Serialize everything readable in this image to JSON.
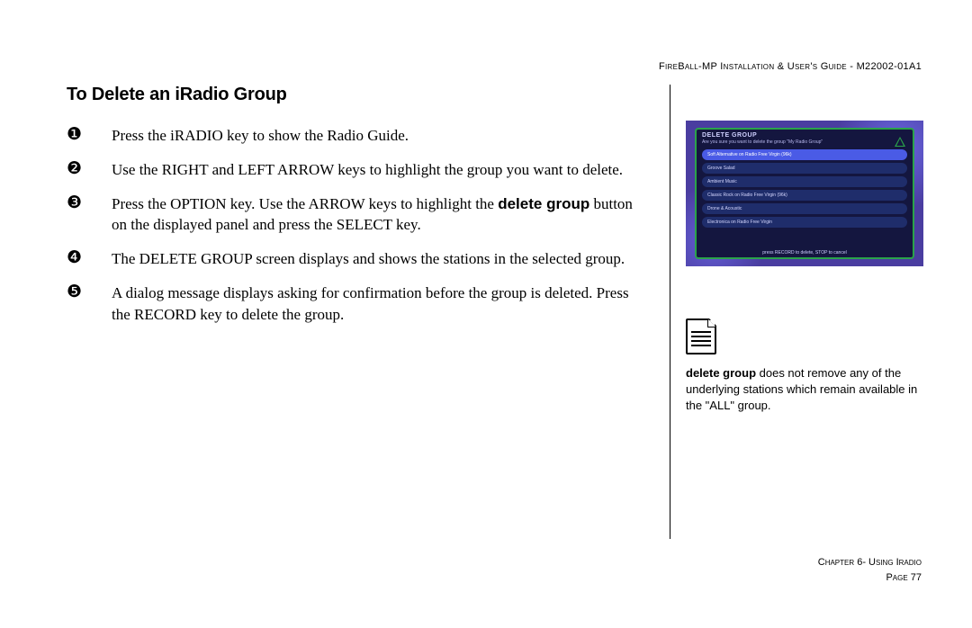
{
  "header": {
    "doc_title": "FireBall-MP Installation & User's Guide - M22002-01A1"
  },
  "section_title": "To Delete an iRadio Group",
  "steps": [
    {
      "num": "❶",
      "html": "Press the iRADIO key to show the Radio Guide."
    },
    {
      "num": "❷",
      "html": "Use the RIGHT and LEFT ARROW keys to highlight the group you want to delete."
    },
    {
      "num": "❸",
      "html": "Press the OPTION key. Use the ARROW keys to highlight the <b>delete group</b> button on the displayed panel and press the SELECT key."
    },
    {
      "num": "❹",
      "html": "The DELETE GROUP screen displays and shows the stations in the selected group."
    },
    {
      "num": "❺",
      "html": "A dialog message displays asking for confirmation before the group is deleted. Press the RECORD key to delete the group."
    }
  ],
  "screenshot": {
    "title": "DELETE GROUP",
    "subtitle": "Are you sure you want to delete the group \"My Radio Group\"",
    "rows": [
      {
        "label": "Soft Alternative on Radio Free Virgin (96k)",
        "active": true
      },
      {
        "label": "Groove Salad",
        "active": false
      },
      {
        "label": "Ambient Music",
        "active": false
      },
      {
        "label": "Classic Rock on Radio Free Virgin (96k)",
        "active": false
      },
      {
        "label": "Drone & Acoustic",
        "active": false
      },
      {
        "label": "Electronica on Radio Free Virgin",
        "active": false
      }
    ],
    "footer": "press RECORD to delete, STOP to cancel"
  },
  "note": {
    "html": "<b>delete group</b> does not remove any of the underlying stations which remain available in the \"ALL\" group."
  },
  "footer": {
    "chapter": "Chapter 6- Using Iradio",
    "page": "Page 77"
  }
}
